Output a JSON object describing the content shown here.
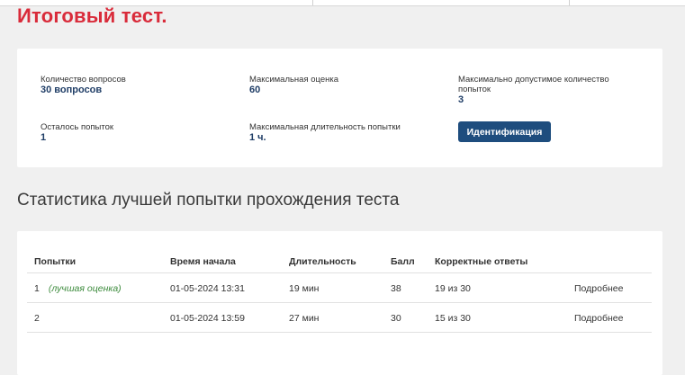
{
  "page": {
    "title": "Итоговый тест."
  },
  "info": {
    "questions_label": "Количество вопросов",
    "questions_value": "30 вопросов",
    "max_score_label": "Максимальная оценка",
    "max_score_value": "60",
    "max_attempts_label": "Максимально допустимое количество попыток",
    "max_attempts_value": "3",
    "remaining_label": "Осталось попыток",
    "remaining_value": "1",
    "max_duration_label": "Максимальная длительность попытки",
    "max_duration_value": "1 ч.",
    "identify_button": "Идентификация"
  },
  "stats": {
    "title": "Статистика лучшей попытки прохождения теста",
    "columns": [
      "Попытки",
      "Время начала",
      "Длительность",
      "Балл",
      "Корректные ответы"
    ],
    "rows": [
      {
        "attempt": "1",
        "best_label": "(лучшая оценка)",
        "start": "01-05-2024 13:31",
        "duration": "19 мин",
        "score": "38",
        "correct": "19 из 30",
        "details": "Подробнее"
      },
      {
        "attempt": "2",
        "best_label": "",
        "start": "01-05-2024 13:59",
        "duration": "27 мин",
        "score": "30",
        "correct": "15 из 30",
        "details": "Подробнее"
      }
    ]
  },
  "colors": {
    "title_red": "#d92b3a",
    "value_navy": "#1f3d66",
    "button_blue": "#1e4d7e",
    "best_green": "#3b8a3b",
    "link_blue": "#2f6aa1",
    "background": "#f0f0f0"
  }
}
